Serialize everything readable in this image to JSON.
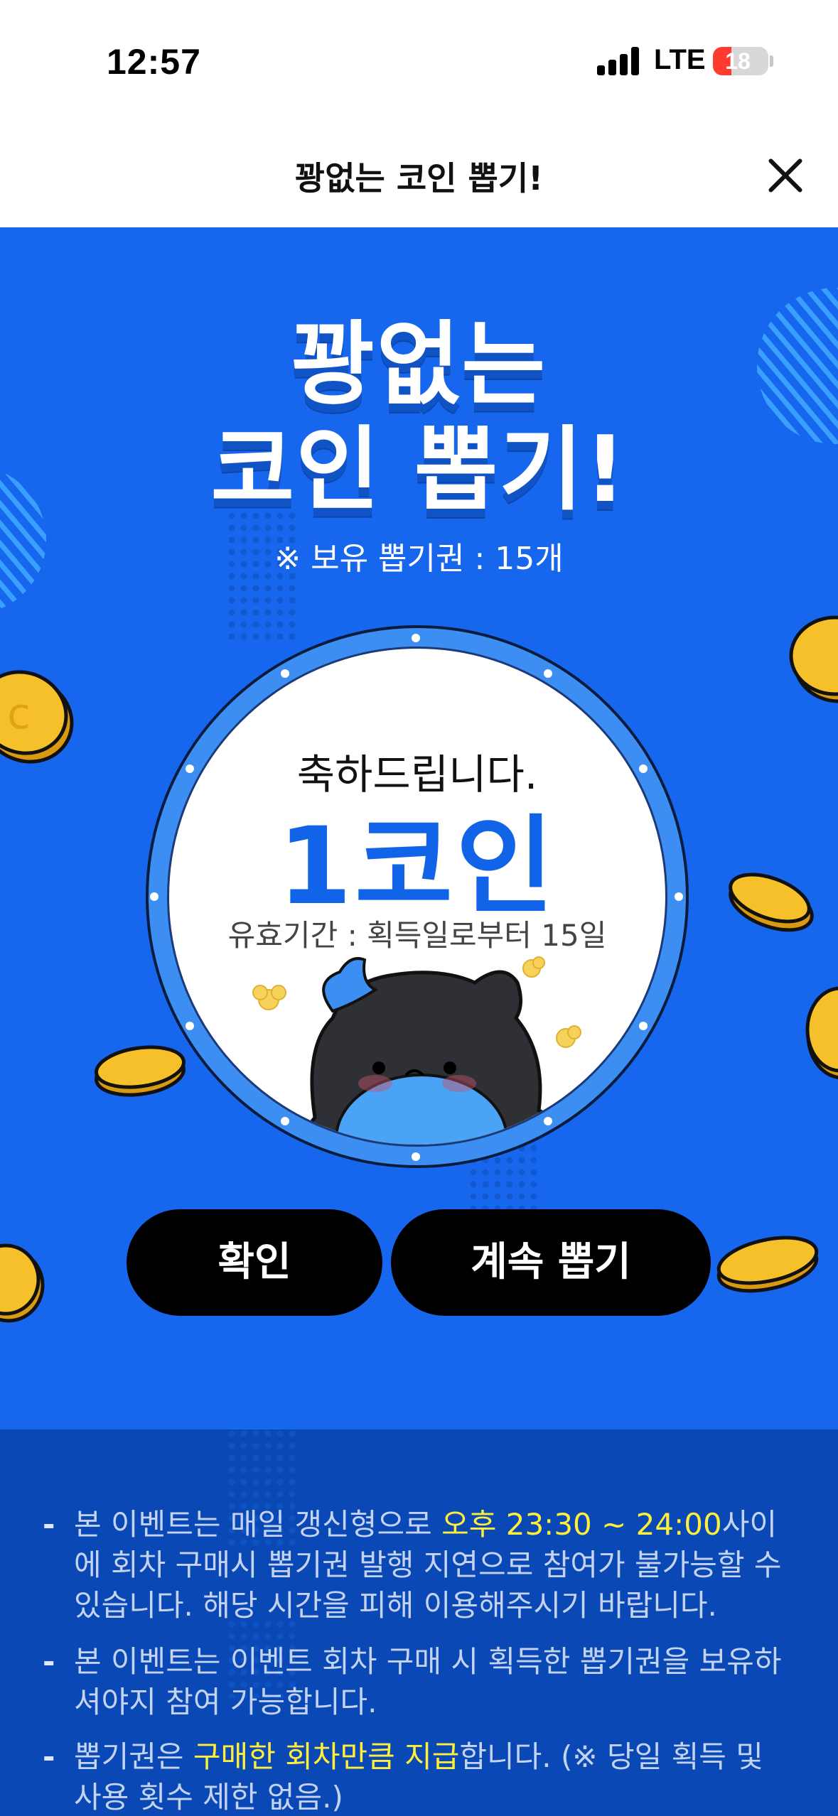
{
  "status_bar": {
    "time": "12:57",
    "network": "LTE",
    "battery": "18"
  },
  "header": {
    "title": "꽝없는 코인 뽑기!"
  },
  "hero": {
    "title_line1": "꽝없는",
    "title_line2": "코인 뽑기!",
    "ticket_info": "※ 보유 뽑기권 : 15개"
  },
  "result": {
    "congrats": "축하드립니다.",
    "reward": "1코인",
    "validity": "유효기간 : 획득일로부터 15일"
  },
  "buttons": {
    "confirm": "확인",
    "continue": "계속 뽑기"
  },
  "notices": [
    {
      "pre": "본 이벤트는 매일 갱신형으로 ",
      "highlight": "오후 23:30 ~ 24:00",
      "post": "사이에 회차 구매시 뽑기권 발행 지연으로 참여가 불가능할 수 있습니다. 해당 시간을 피해 이용해주시기 바랍니다."
    },
    {
      "pre": "본 이벤트는 이벤트 회차 구매 시 획득한 뽑기권을 보유하셔야지 참여 가능합니다.",
      "highlight": "",
      "post": ""
    },
    {
      "pre": "뽑기권은 ",
      "highlight": "구매한 회차만큼 지급",
      "post": "합니다. (※ 당일 획득 및 사용 횟수 제한 없음.)"
    }
  ],
  "colors": {
    "panel_bg": "#1767ee",
    "notice_bg": "#0a48b5",
    "reward_text": "#1163e8",
    "highlight": "#ffee3a",
    "coin": "#f5c02a"
  }
}
